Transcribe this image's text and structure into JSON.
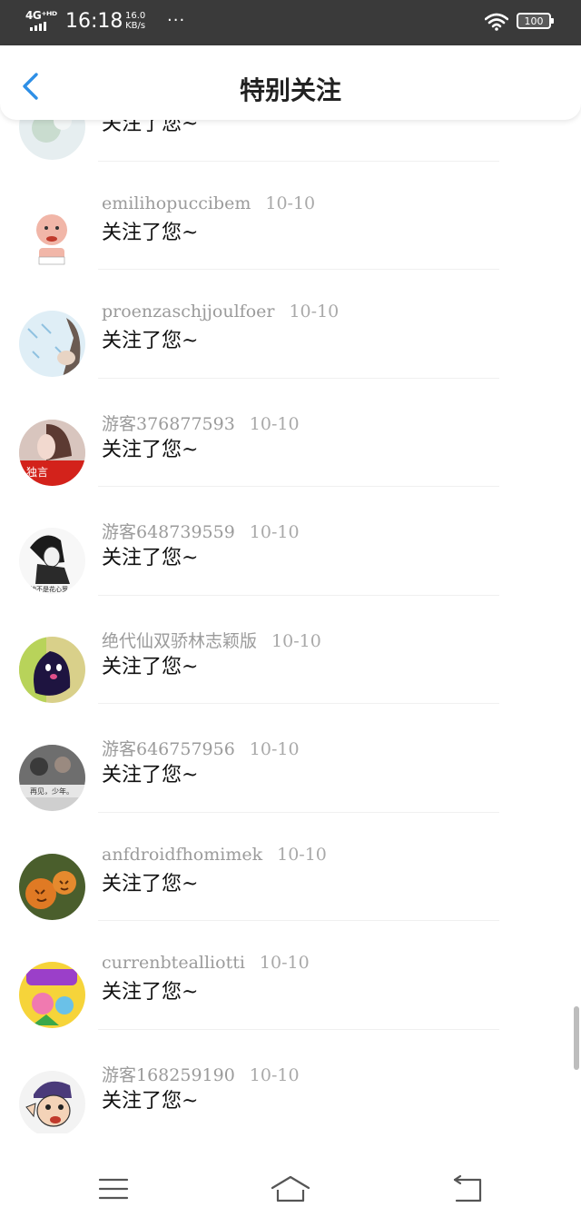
{
  "status_bar": {
    "network": "4G⁺ᴴᴰ",
    "time": "16:18",
    "speed_value": "16.0",
    "speed_unit": "KB/s",
    "more": "···",
    "battery": "100"
  },
  "header": {
    "title": "特别关注",
    "back_icon": "chevron-left-icon",
    "accent_color": "#2e8fe6"
  },
  "items": [
    {
      "name": "",
      "date": "",
      "message": "关注了您~"
    },
    {
      "name": "emilihopuccibem",
      "date": "10-10",
      "message": "关注了您~"
    },
    {
      "name": "proenzaschjjoulfoer",
      "date": "10-10",
      "message": "关注了您~"
    },
    {
      "name": "游客376877593",
      "date": "10-10",
      "message": "关注了您~"
    },
    {
      "name": "游客648739559",
      "date": "10-10",
      "message": "关注了您~"
    },
    {
      "name": "绝代仙双骄林志颖版",
      "date": "10-10",
      "message": "关注了您~"
    },
    {
      "name": "游客646757956",
      "date": "10-10",
      "message": "关注了您~"
    },
    {
      "name": "anfdroidfhomimek",
      "date": "10-10",
      "message": "关注了您~"
    },
    {
      "name": "currenbtealliotti",
      "date": "10-10",
      "message": "关注了您~"
    },
    {
      "name": "游客168259190",
      "date": "10-10",
      "message": "关注了您~"
    }
  ],
  "nav": {
    "menu_icon": "menu-icon",
    "home_icon": "home-icon",
    "back_icon": "back-arrow-icon"
  }
}
